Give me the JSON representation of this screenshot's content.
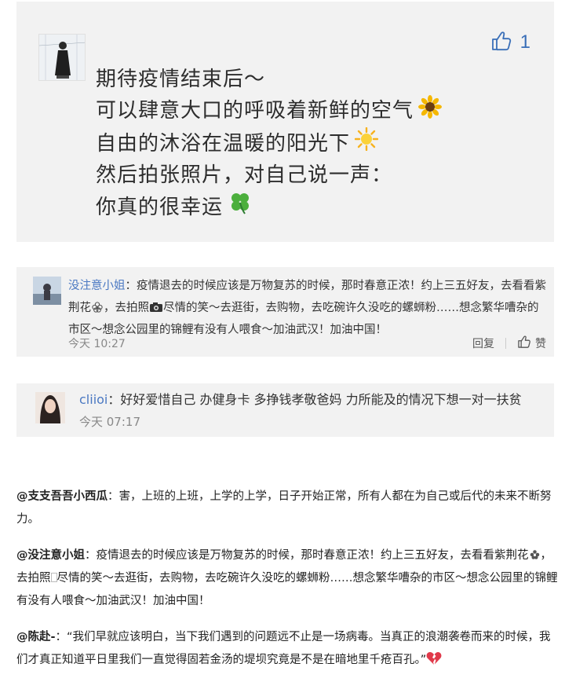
{
  "main_comment": {
    "likes": "1",
    "lines": [
      {
        "text": "期待疫情结束后～",
        "emoji": ""
      },
      {
        "text": "可以肆意大口的呼吸着新鲜的空气",
        "emoji": "sunflower"
      },
      {
        "text": "自由的沐浴在温暖的阳光下",
        "emoji": "sun"
      },
      {
        "text": "然后拍张照片，对自己说一声：",
        "emoji": ""
      },
      {
        "text": "你真的很幸运",
        "emoji": "four-leaf-clover"
      }
    ]
  },
  "comment2": {
    "username": "没注意小姐",
    "text_a": "：疫情退去的时候应该是万物复苏的时候，那时春意正浓！约上三五好友，去看看紫荆花",
    "text_b": "，去拍照",
    "text_c": "尽情的笑～去逛街，去购物，去吃碗许久没吃的螺蛳粉……想念繁华嘈杂的市区～想念公园里的锦鲤有没有人喂食～加油武汉！加油中国！",
    "time": "今天 10:27",
    "reply_label": "回复",
    "like_label": "赞"
  },
  "comment3": {
    "username": "cliioi",
    "text": "：好好爱惜自己 办健身卡 多挣钱孝敬爸妈 力所能及的情况下想一对一扶贫",
    "time": "今天 07:17"
  },
  "article": [
    {
      "author": "@支支吾吾小西瓜",
      "text": "：害，上班的上班，上学的上学，日子开始正常，所有人都在为自己或后代的未来不断努力。"
    },
    {
      "author": "@没注意小姐",
      "text": "：疫情退去的时候应该是万物复苏的时候，那时春意正浓！约上三五好友，去看看紫荆花",
      "text2": "，去拍照",
      "text3": "尽情的笑～去逛街，去购物，去吃碗许久没吃的螺蛳粉……想念繁华嘈杂的市区～想念公园里的锦鲤有没有人喂食～加油武汉！加油中国！"
    },
    {
      "author": "@陈赴-",
      "text": "：“我们早就应该明白，当下我们遇到的问题远不止是一场病毒。当真正的浪潮袭卷而来的时候，我们才真正知道平日里我们一直觉得固若金汤的堤坝究竟是不是在暗地里千疮百孔。”",
      "emoji": "broken-heart"
    }
  ],
  "colors": {
    "card_bg": "#f2f2f2",
    "username": "#4a78c2",
    "like": "#3a6fb8",
    "muted": "#888888"
  }
}
